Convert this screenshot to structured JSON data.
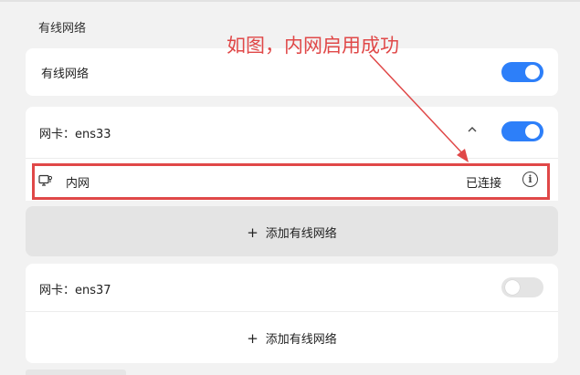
{
  "wired_section": {
    "title": "有线网络"
  },
  "wired_master": {
    "label": "有线网络",
    "toggle_on": true
  },
  "adapter_1": {
    "label": "网卡：ens33",
    "toggle_on": true,
    "expanded": true,
    "chevron_icon": "chevron-up-icon",
    "network": {
      "icon": "ethernet-icon",
      "name": "内网",
      "status": "已连接",
      "info_icon": "info-icon"
    },
    "add_label": "添加有线网络",
    "plus_icon": "plus-icon"
  },
  "adapter_2": {
    "label": "网卡：ens37",
    "toggle_on": false,
    "add_label": "添加有线网络",
    "plus_icon": "plus-icon"
  },
  "annotation": {
    "text": "如图，内网启用成功",
    "color": "#e04848"
  },
  "colors": {
    "accent": "#2d7ff9",
    "toggle_off": "#e4e4e4",
    "card": "#ffffff",
    "background": "#f2f2f2"
  }
}
